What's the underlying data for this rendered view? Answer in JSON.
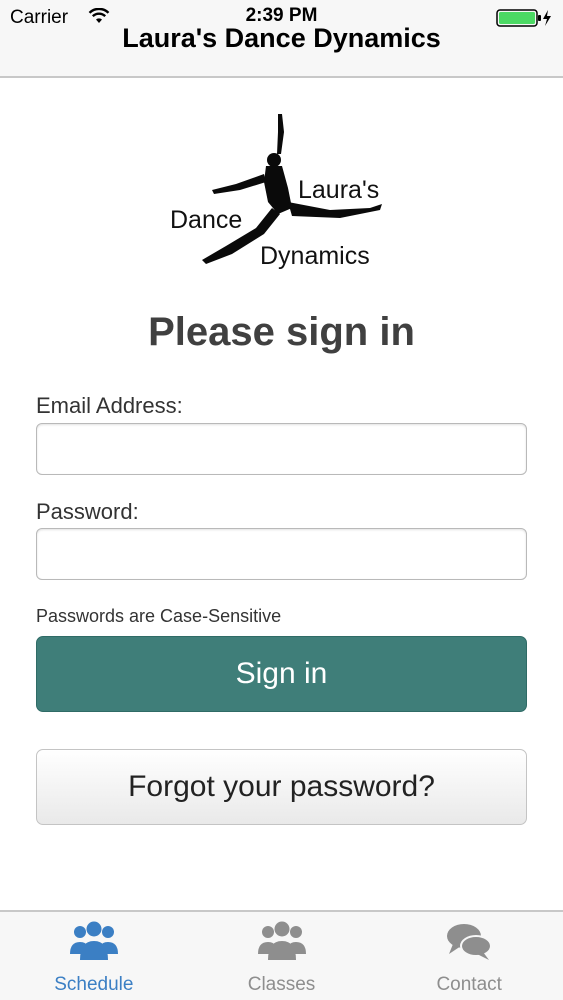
{
  "status_bar": {
    "carrier": "Carrier",
    "time": "2:39 PM",
    "battery_color": "#4cd964"
  },
  "nav": {
    "title": "Laura's Dance Dynamics"
  },
  "logo": {
    "line1": "Laura's",
    "line2": "Dance",
    "line3": "Dynamics"
  },
  "form": {
    "heading": "Please sign in",
    "email_label": "Email Address:",
    "email_value": "",
    "password_label": "Password:",
    "password_value": "",
    "hint": "Passwords are Case-Sensitive",
    "signin_label": "Sign in",
    "forgot_label": "Forgot your password?"
  },
  "colors": {
    "primary": "#3f7e79",
    "tab_active": "#3b7fc4",
    "tab_inactive": "#8e8e8e"
  },
  "tabs": [
    {
      "label": "Schedule",
      "icon": "people-group-icon",
      "active": true
    },
    {
      "label": "Classes",
      "icon": "people-group-icon",
      "active": false
    },
    {
      "label": "Contact",
      "icon": "chat-bubbles-icon",
      "active": false
    }
  ]
}
